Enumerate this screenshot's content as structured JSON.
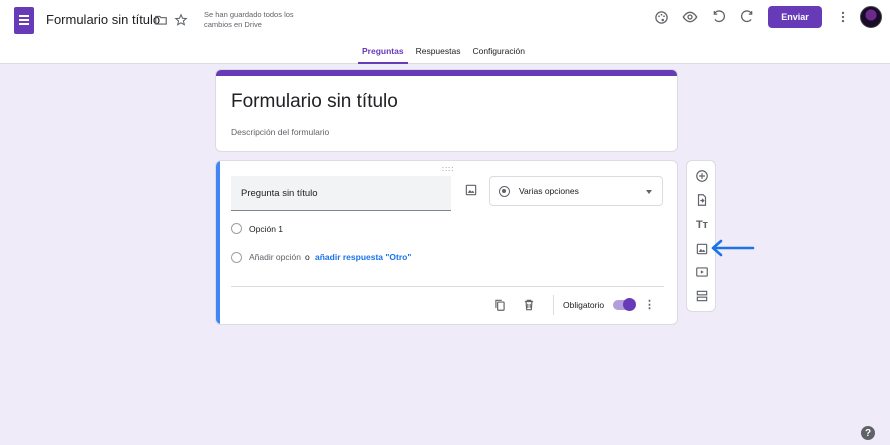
{
  "header": {
    "doc_title": "Formulario sin título",
    "save_status": "Se han guardado todos los cambios en Drive",
    "send_label": "Enviar",
    "icons": [
      "forms-logo-icon",
      "folder-icon",
      "star-icon",
      "palette-icon",
      "eye-icon",
      "undo-icon",
      "redo-icon",
      "more-vert-icon"
    ]
  },
  "tabs": [
    {
      "label": "Preguntas",
      "active": true
    },
    {
      "label": "Respuestas",
      "active": false
    },
    {
      "label": "Configuración",
      "active": false
    }
  ],
  "form": {
    "title": "Formulario sin título",
    "description_placeholder": "Descripción del formulario"
  },
  "question": {
    "title": "Pregunta sin título",
    "type": "Varias opciones",
    "option_1": "Opción 1",
    "add_option": "Añadir opción",
    "or": "o",
    "add_other": "añadir respuesta \"Otro\"",
    "required_label": "Obligatorio",
    "required": true
  },
  "side_toolbar": [
    "add-question-icon",
    "import-questions-icon",
    "add-title-icon",
    "add-image-icon",
    "add-video-icon",
    "add-section-icon"
  ],
  "colors": {
    "accent": "#673ab7",
    "background": "#f0ebf8",
    "focus_bar": "#4285f4",
    "link": "#1a73e8",
    "arrow": "#1a73e8"
  }
}
